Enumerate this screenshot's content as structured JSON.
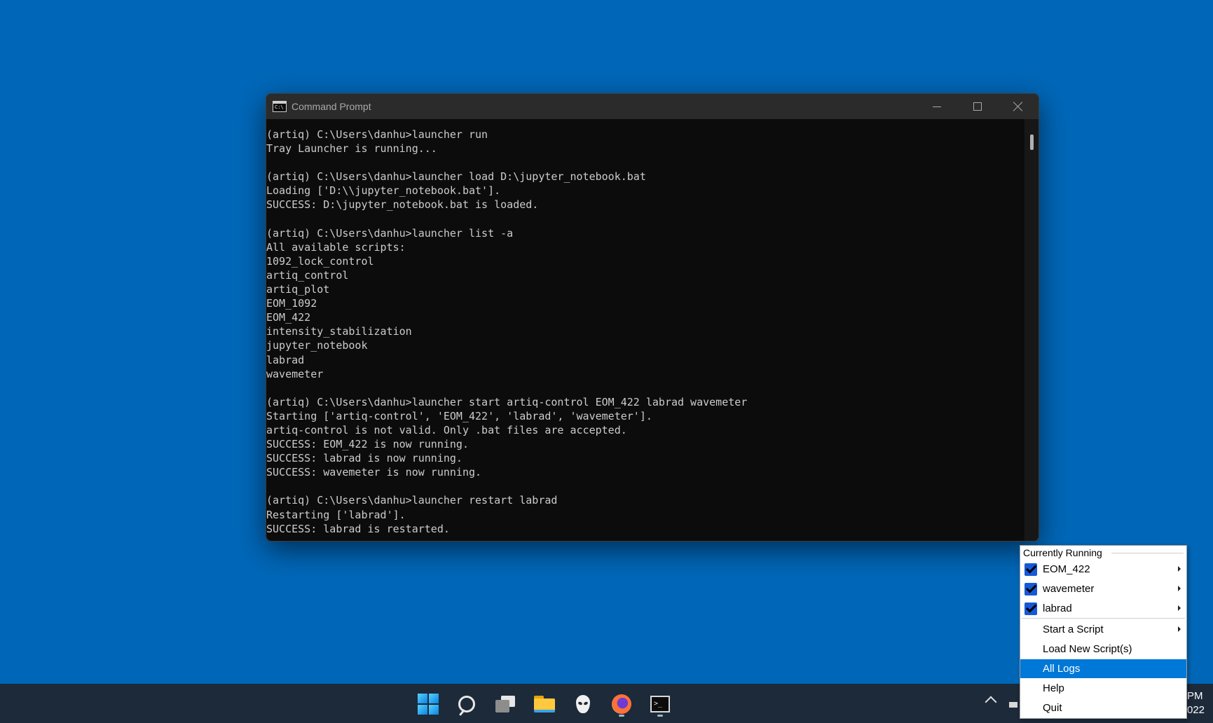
{
  "window": {
    "title": "Command Prompt",
    "title_icon_text": "C:\\"
  },
  "console": {
    "lines": [
      "(artiq) C:\\Users\\danhu>launcher run",
      "Tray Launcher is running...",
      "",
      "(artiq) C:\\Users\\danhu>launcher load D:\\jupyter_notebook.bat",
      "Loading ['D:\\\\jupyter_notebook.bat'].",
      "SUCCESS: D:\\jupyter_notebook.bat is loaded.",
      "",
      "(artiq) C:\\Users\\danhu>launcher list -a",
      "All available scripts:",
      "1092_lock_control",
      "artiq_control",
      "artiq_plot",
      "EOM_1092",
      "EOM_422",
      "intensity_stabilization",
      "jupyter_notebook",
      "labrad",
      "wavemeter",
      "",
      "(artiq) C:\\Users\\danhu>launcher start artiq-control EOM_422 labrad wavemeter",
      "Starting ['artiq-control', 'EOM_422', 'labrad', 'wavemeter'].",
      "artiq-control is not valid. Only .bat files are accepted.",
      "SUCCESS: EOM_422 is now running.",
      "SUCCESS: labrad is now running.",
      "SUCCESS: wavemeter is now running.",
      "",
      "(artiq) C:\\Users\\danhu>launcher restart labrad",
      "Restarting ['labrad'].",
      "SUCCESS: labrad is restarted."
    ]
  },
  "tray_menu": {
    "section_label": "Currently Running",
    "running": [
      {
        "label": "EOM_422",
        "checked": true
      },
      {
        "label": "wavemeter",
        "checked": true
      },
      {
        "label": "labrad",
        "checked": true
      }
    ],
    "actions": [
      {
        "label": "Start a Script",
        "submenu": true
      },
      {
        "label": "Load New Script(s)",
        "submenu": false
      },
      {
        "label": "All Logs",
        "submenu": false,
        "highlighted": true
      },
      {
        "label": "Help",
        "submenu": false
      },
      {
        "label": "Quit",
        "submenu": false
      }
    ]
  },
  "taskbar": {
    "clock_time": "PM",
    "clock_date": "022",
    "apps": [
      "start-icon",
      "search-icon",
      "task-view-icon",
      "file-explorer-icon",
      "alienware-icon",
      "firefox-icon",
      "terminal-icon"
    ]
  },
  "colors": {
    "desktop": "#0067b8",
    "menu_highlight": "#0078d7",
    "checkbox": "#1559d6"
  }
}
